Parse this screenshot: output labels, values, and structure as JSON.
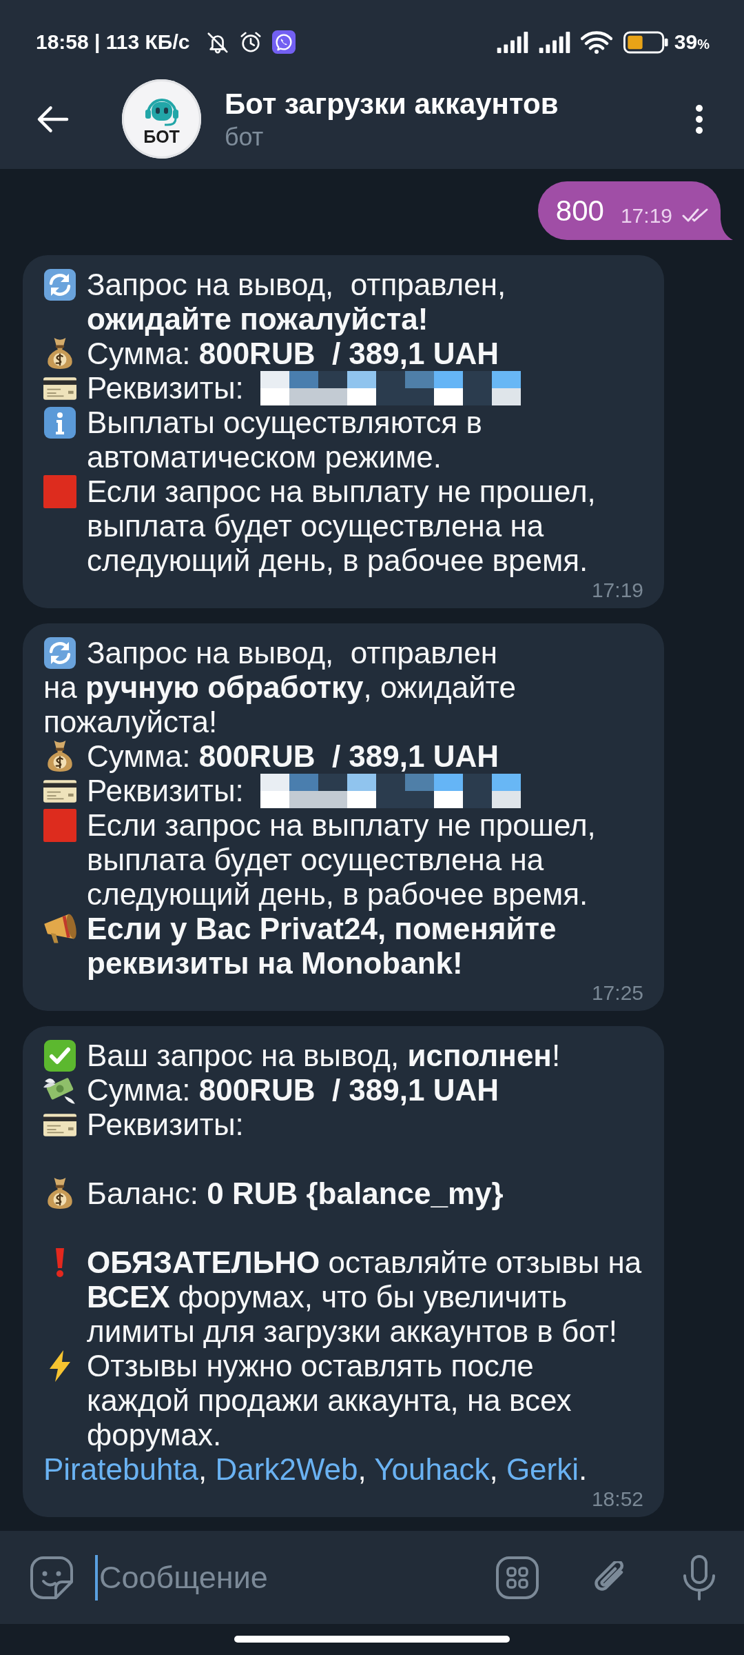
{
  "status_bar": {
    "time": "18:58 | 113 КБ/с",
    "battery": "39",
    "battery_unit": "%"
  },
  "header": {
    "avatar_label": "БОТ",
    "title": "Бот загрузки аккаунтов",
    "subtitle": "бот"
  },
  "messages": [
    {
      "kind": "outgoing",
      "text": "800",
      "time": "17:19",
      "read": true
    },
    {
      "kind": "incoming",
      "time": "17:19",
      "blocks": [
        [
          {
            "kind": "refresh",
            "text": "Запрос на вывод,  отправлен, **ожидайте пожалуйста!**"
          },
          {
            "kind": "moneybag",
            "text": "Сумма: **800RUB  / 389,1 UAH**"
          },
          {
            "kind": "card",
            "text": "Реквизиты:",
            "redacted": true
          },
          {
            "kind": "info",
            "text": "Выплаты осуществляются в автоматическом режиме."
          },
          {
            "kind": "redsquare",
            "text": "Если запрос на выплату не прошел, выплата будет осуществлена на следующий день, в рабочее время."
          }
        ]
      ]
    },
    {
      "kind": "incoming",
      "time": "17:25",
      "blocks": [
        [
          {
            "kind": "refresh",
            "text": "Запрос на вывод,  отправлен"
          },
          {
            "kind": "plain",
            "text": "на **ручную обработку**, ожидайте пожалуйста!"
          },
          {
            "kind": "moneybag",
            "text": "Сумма: **800RUB  / 389,1 UAH**"
          },
          {
            "kind": "card",
            "text": "Реквизиты:",
            "redacted": true
          },
          {
            "kind": "redsquare",
            "text": "Если запрос на выплату не прошел, выплата будет осуществлена на следующий день, в рабочее время."
          },
          {
            "kind": "megaphone",
            "text": "Если у Вас Privat24, поменяйте реквизиты на Monobank!",
            "bold": true
          }
        ]
      ]
    },
    {
      "kind": "incoming",
      "time": "18:52",
      "blocks": [
        [
          {
            "kind": "check",
            "text": "Ваш запрос на вывод, **исполнен**!"
          },
          {
            "kind": "moneywings",
            "text": "Сумма: **800RUB  / 389,1 UAH**"
          },
          {
            "kind": "card",
            "text": "Реквизиты:"
          }
        ],
        [
          {
            "kind": "moneybag",
            "text": "Баланс: **0 RUB {balance_my}**"
          }
        ],
        [
          {
            "kind": "exclamation",
            "text": "**ОБЯЗАТЕЛЬНО** оставляйте отзывы на **ВСЕХ** форумах, что бы увеличить лимиты для загрузки аккаунтов в бот!"
          },
          {
            "kind": "lightning",
            "text": "Отзывы нужно оставлять после каждой продажи аккаунта, на всех форумах."
          },
          {
            "kind": "links",
            "links": [
              "Piratebuhta",
              "Dark2Web",
              "Youhack",
              "Gerki"
            ],
            "separator": ", ",
            "end": "."
          }
        ]
      ]
    }
  ],
  "input": {
    "placeholder": "Сообщение"
  }
}
